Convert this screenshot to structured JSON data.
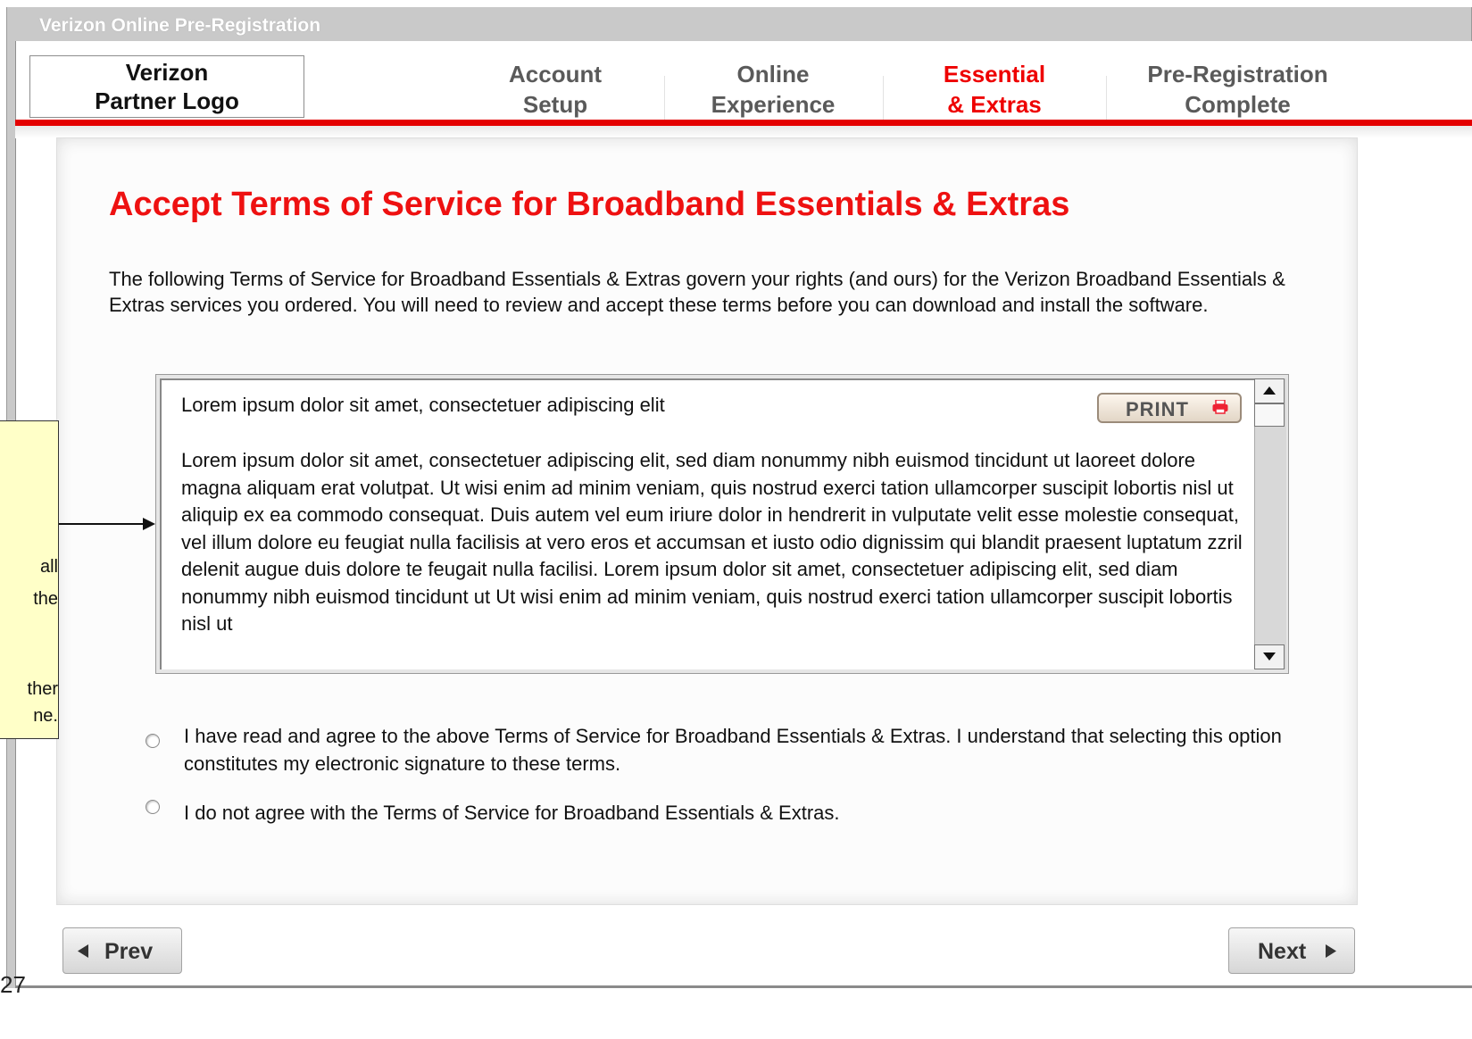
{
  "window": {
    "title": "Verizon Online Pre-Registration"
  },
  "header": {
    "logo_line1": "Verizon",
    "logo_line2": "Partner Logo",
    "tabs": [
      {
        "line1": "Account",
        "line2": "Setup",
        "active": false
      },
      {
        "line1": "Online",
        "line2": "Experience",
        "active": false
      },
      {
        "line1": "Essential",
        "line2": "& Extras",
        "active": true
      },
      {
        "line1": "Pre-Registration",
        "line2": "Complete",
        "active": false
      }
    ]
  },
  "main": {
    "title": "Accept Terms of Service for Broadband Essentials & Extras",
    "intro": "The following Terms of Service for Broadband Essentials & Extras govern your rights (and ours) for the Verizon Broadband Essentials & Extras services you ordered.  You will need to review and accept these terms before you can download and install the software.",
    "terms": {
      "heading": "Lorem ipsum dolor sit amet, consectetuer adipiscing elit",
      "body": "Lorem ipsum dolor sit amet, consectetuer adipiscing elit, sed diam nonummy nibh euismod tincidunt ut laoreet dolore magna aliquam erat volutpat. Ut wisi enim ad minim veniam, quis nostrud exerci tation ullamcorper suscipit lobortis nisl ut aliquip ex ea commodo consequat. Duis autem vel eum iriure dolor in hendrerit in vulputate velit esse molestie consequat, vel illum dolore eu feugiat nulla facilisis at vero eros et accumsan et iusto odio dignissim qui blandit praesent luptatum zzril delenit augue duis dolore te feugait nulla facilisi. Lorem ipsum dolor sit amet, consectetuer adipiscing elit, sed diam nonummy nibh euismod tincidunt ut Ut wisi enim ad minim veniam, quis nostrud exerci tation ullamcorper suscipit lobortis nisl ut",
      "print_label": "PRINT"
    },
    "options": {
      "agree": "I have read and agree to the above Terms of Service for Broadband Essentials & Extras.  I understand that selecting this option constitutes my electronic signature to these terms.",
      "disagree": "I do not agree with the Terms of Service for Broadband Essentials & Extras."
    }
  },
  "callout": {
    "fragments": [
      "all",
      "the",
      "ther",
      "ne."
    ]
  },
  "nav": {
    "prev_label": "Prev",
    "next_label": "Next"
  },
  "page_number": "27",
  "colors": {
    "accent_red": "#ee0000",
    "callout_bg": "#ffffc8"
  }
}
